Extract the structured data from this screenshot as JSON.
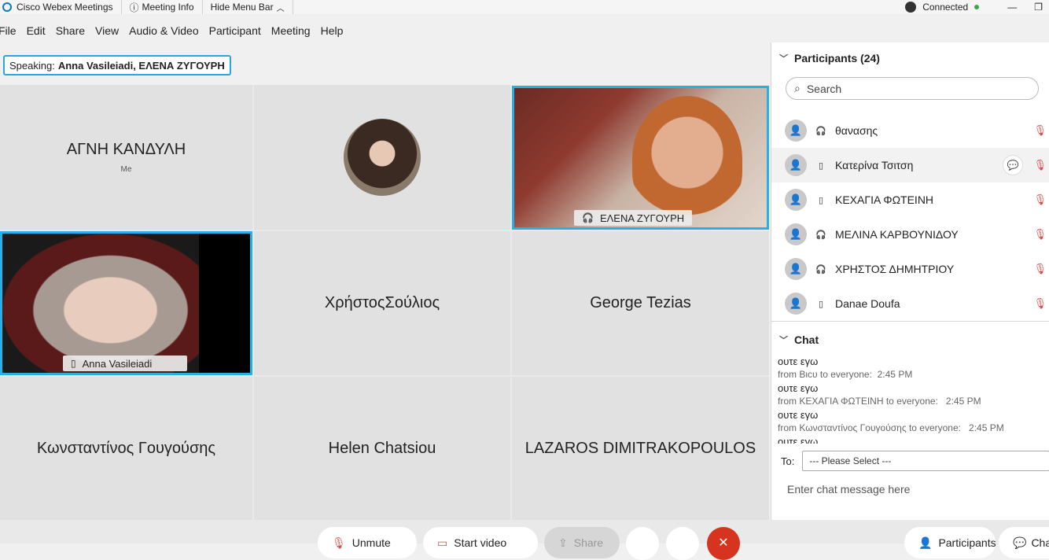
{
  "titlebar": {
    "app_name": "Cisco Webex Meetings",
    "meeting_info": "Meeting Info",
    "hide_menu": "Hide Menu Bar",
    "status": "Connected"
  },
  "menu": [
    "File",
    "Edit",
    "Share",
    "View",
    "Audio & Video",
    "Participant",
    "Meeting",
    "Help"
  ],
  "speaking": {
    "label": "Speaking:",
    "names": "Anna Vasileiadi, ΕΛΕΝΑ ΖΥΓΟΥΡΗ"
  },
  "tiles": {
    "t1": {
      "name": "ΑΓΝΗ ΚΑΝΔΥΛΗ",
      "sub": "Me"
    },
    "t3": {
      "name": "ΕΛΕΝΑ ΖΥΓΟΥΡΗ"
    },
    "t4": {
      "name": "Anna Vasileiadi"
    },
    "t5": {
      "name": "ΧρήστοςΣούλιος"
    },
    "t6": {
      "name": "George Tezias"
    },
    "t7": {
      "name": "Κωνσταντίνος Γουγούσης"
    },
    "t8": {
      "name": "Helen Chatsiou"
    },
    "t9": {
      "name": "LAZAROS DIMITRAKOPOULOS"
    }
  },
  "participants": {
    "title": "Participants (24)",
    "search_placeholder": "Search",
    "list": [
      {
        "name": "θανασης"
      },
      {
        "name": "Κατερίνα Τσιτση"
      },
      {
        "name": "ΚΕΧΑΓΙΑ ΦΩΤΕΙΝΗ"
      },
      {
        "name": "ΜΕΛΙΝΑ ΚΑΡΒΟΥΝΙΔΟΥ"
      },
      {
        "name": "ΧΡΗΣΤΟΣ ΔΗΜΗΤΡΙΟΥ"
      },
      {
        "name": "Danae Doufa"
      }
    ]
  },
  "chat": {
    "title": "Chat",
    "messages": [
      {
        "text": "ουτε εγω",
        "from": "from Βιcυ to everyone:",
        "time": "2:45 PM"
      },
      {
        "text": "ουτε εγω",
        "from": "from ΚΕΧΑΓΙΑ ΦΩΤΕΙΝΗ to everyone:",
        "time": "2:45 PM"
      },
      {
        "text": "ουτε εγω",
        "from": "from Κωνσταντίνος Γουγούσης to everyone:",
        "time": "2:45 PM"
      },
      {
        "text": "ουτε εγω"
      }
    ],
    "to_label": "To:",
    "to_value": "--- Please Select ---",
    "input_placeholder": "Enter chat message here"
  },
  "bottom": {
    "unmute": "Unmute",
    "start_video": "Start video",
    "share": "Share",
    "participants": "Participants",
    "chat": "Chat"
  },
  "colors": {
    "accent": "#27b0e8",
    "leave": "#d6341f",
    "muted": "#e04848"
  }
}
